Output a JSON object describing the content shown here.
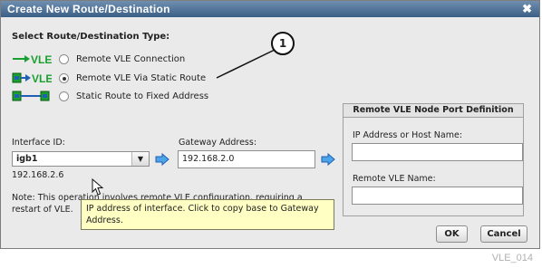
{
  "dialog": {
    "title": "Create New Route/Destination",
    "close_icon": "✖"
  },
  "route_type": {
    "label": "Select Route/Destination Type:",
    "options": [
      {
        "label": "Remote VLE Connection",
        "checked": false,
        "icon": "vle-arrow-icon"
      },
      {
        "label": "Remote VLE Via Static Route",
        "checked": true,
        "icon": "static-route-vle-icon"
      },
      {
        "label": "Static Route to Fixed Address",
        "checked": false,
        "icon": "static-route-fixed-icon"
      }
    ],
    "vle_text": "VLE"
  },
  "callout": {
    "number": "1"
  },
  "interface": {
    "label": "Interface ID:",
    "value": "igb1",
    "address": "192.168.2.6"
  },
  "gateway": {
    "label": "Gateway Address:",
    "value": "192.168.2.0"
  },
  "node_port": {
    "title": "Remote VLE Node Port Definition",
    "ip_label": "IP Address or Host Name:",
    "ip_value": "",
    "name_label": "Remote VLE Name:",
    "name_value": ""
  },
  "note": "Note: This operation involves remote VLE configuration, requiring a restart of VLE.",
  "tooltip": "IP address of interface. Click to copy base to Gateway Address.",
  "buttons": {
    "ok": "OK",
    "cancel": "Cancel"
  },
  "caption": "VLE_014",
  "colors": {
    "title_bar": "#4a6d94",
    "accent_green": "#1aa030",
    "accent_blue": "#1f5fb5",
    "tooltip_bg": "#ffffc4"
  }
}
